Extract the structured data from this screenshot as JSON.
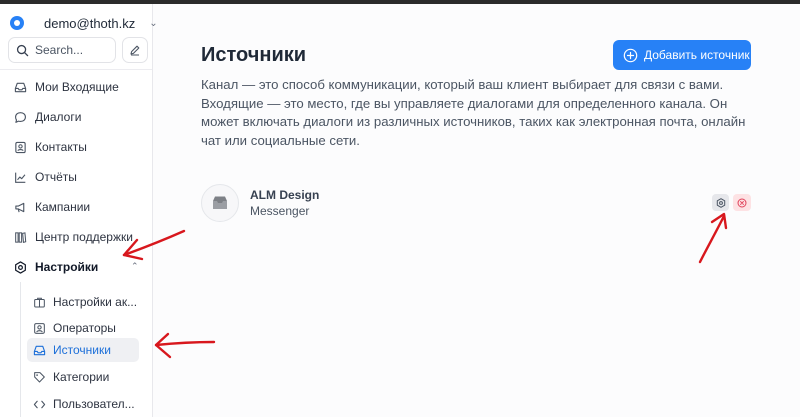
{
  "account": {
    "name": "demo@thoth.kz"
  },
  "search": {
    "placeholder": "Search..."
  },
  "nav": {
    "items": [
      {
        "label": "Мои Входящие"
      },
      {
        "label": "Диалоги"
      },
      {
        "label": "Контакты"
      },
      {
        "label": "Отчёты"
      },
      {
        "label": "Кампании"
      },
      {
        "label": "Центр поддержки"
      },
      {
        "label": "Настройки"
      }
    ],
    "settings_sub": [
      {
        "label": "Настройки ак..."
      },
      {
        "label": "Операторы"
      },
      {
        "label": "Источники",
        "active": true
      },
      {
        "label": "Категории"
      },
      {
        "label": "Пользовател..."
      }
    ]
  },
  "page": {
    "title": "Источники",
    "add_button": "Добавить источник",
    "description": "Канал — это способ коммуникации, который ваш клиент выбирает для связи с вами. Входящие — это место, где вы управляете диалогами для определенного канала. Он может включать диалоги из различных источников, таких как электронная почта, онлайн чат или социальные сети."
  },
  "inboxes": [
    {
      "name": "ALM Design",
      "channel": "Messenger"
    }
  ],
  "colors": {
    "accent": "#2781f6",
    "active_text": "#1c6fd9",
    "annotation": "#d8171d",
    "delete_bg": "#fde2e4"
  }
}
